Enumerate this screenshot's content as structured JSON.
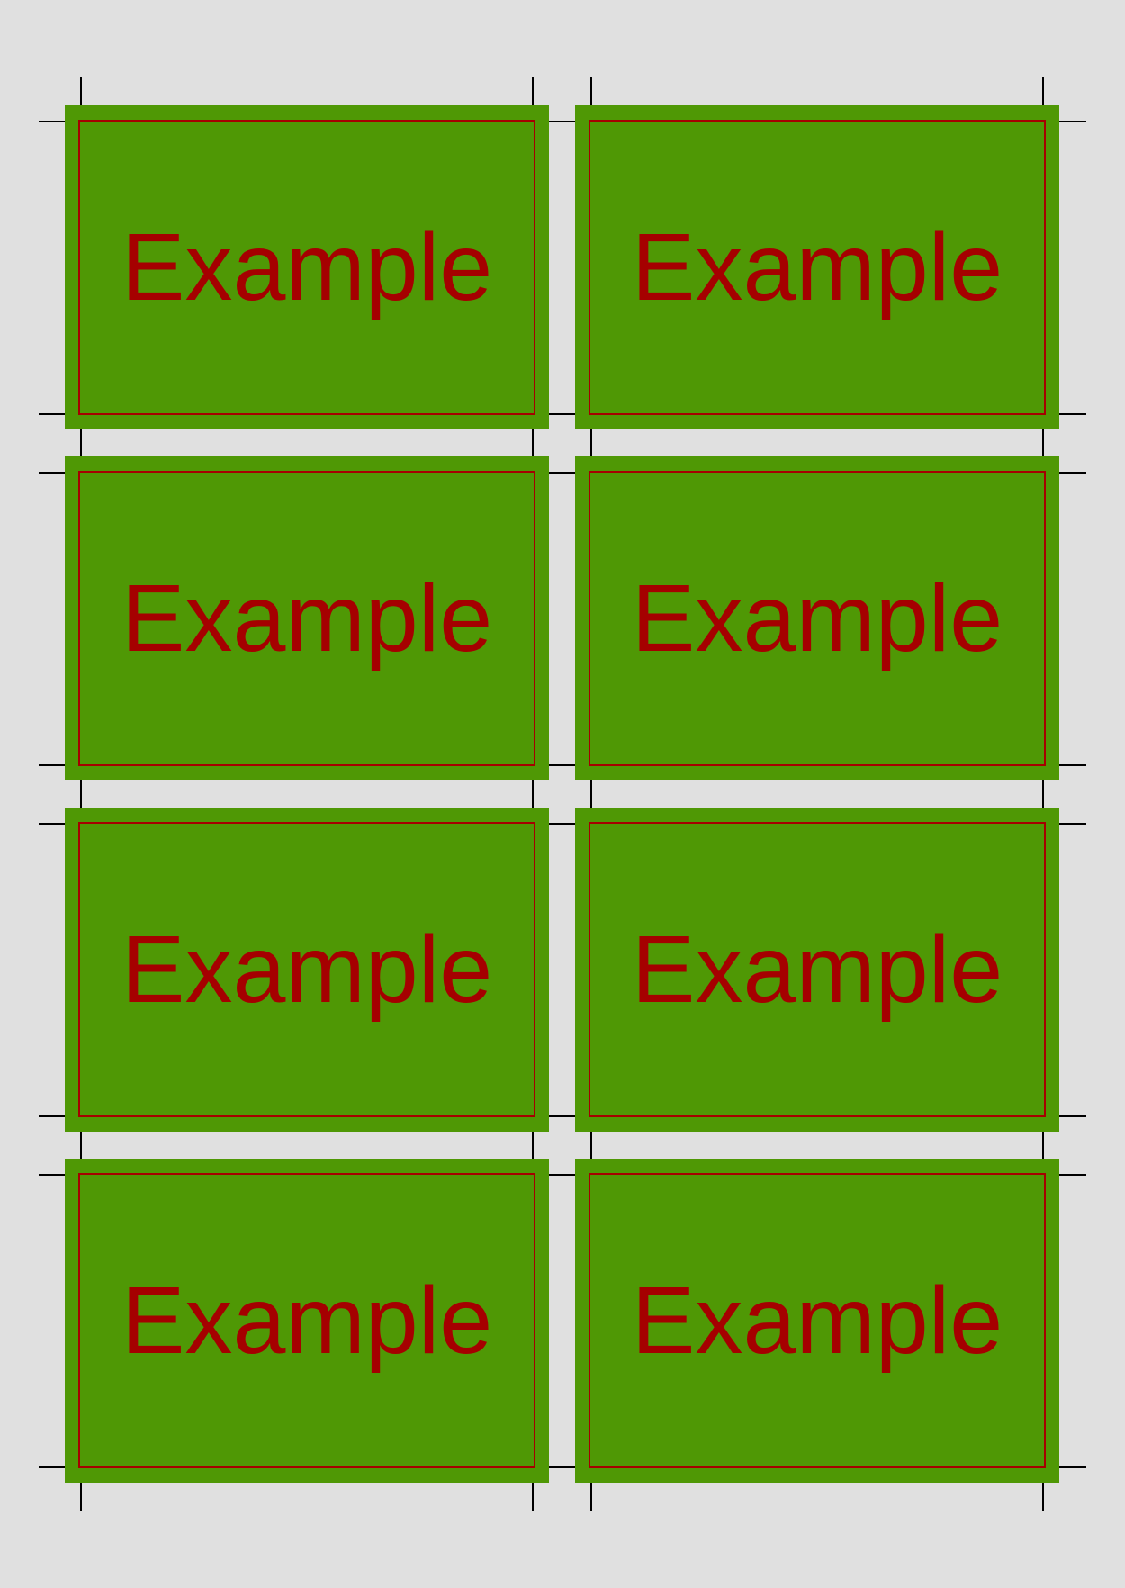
{
  "sheet": {
    "background_color": "#e0e0e0",
    "card_color": "#4f9805",
    "accent_color": "#a50000",
    "crop_mark_color": "#000000",
    "columns": 2,
    "rows": 4
  },
  "cards": [
    {
      "label": "Example"
    },
    {
      "label": "Example"
    },
    {
      "label": "Example"
    },
    {
      "label": "Example"
    },
    {
      "label": "Example"
    },
    {
      "label": "Example"
    },
    {
      "label": "Example"
    },
    {
      "label": "Example"
    }
  ]
}
